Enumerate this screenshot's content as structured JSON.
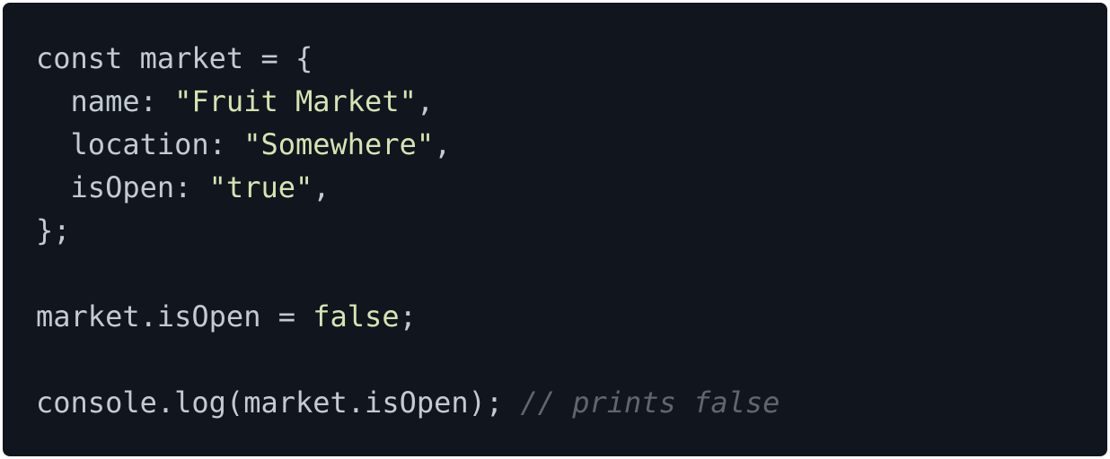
{
  "code_block": {
    "lines": [
      {
        "tokens": [
          {
            "text": "const market = {",
            "kind": "plain"
          }
        ]
      },
      {
        "tokens": [
          {
            "text": "  name: ",
            "kind": "plain"
          },
          {
            "text": "\"Fruit Market\"",
            "kind": "string"
          },
          {
            "text": ",",
            "kind": "plain"
          }
        ]
      },
      {
        "tokens": [
          {
            "text": "  location: ",
            "kind": "plain"
          },
          {
            "text": "\"Somewhere\"",
            "kind": "string"
          },
          {
            "text": ",",
            "kind": "plain"
          }
        ]
      },
      {
        "tokens": [
          {
            "text": "  isOpen: ",
            "kind": "plain"
          },
          {
            "text": "\"true\"",
            "kind": "string"
          },
          {
            "text": ",",
            "kind": "plain"
          }
        ]
      },
      {
        "tokens": [
          {
            "text": "};",
            "kind": "plain"
          }
        ]
      },
      {
        "tokens": []
      },
      {
        "tokens": [
          {
            "text": "market.isOpen = ",
            "kind": "plain"
          },
          {
            "text": "false",
            "kind": "literal"
          },
          {
            "text": ";",
            "kind": "plain"
          }
        ]
      },
      {
        "tokens": []
      },
      {
        "tokens": [
          {
            "text": "console.log(market.isOpen); ",
            "kind": "plain"
          },
          {
            "text": "// prints false",
            "kind": "comment"
          }
        ]
      }
    ]
  },
  "colors": {
    "background": "#11151d",
    "plain": "#c3cad3",
    "string": "#d6e3b3",
    "comment": "#5f6671"
  }
}
